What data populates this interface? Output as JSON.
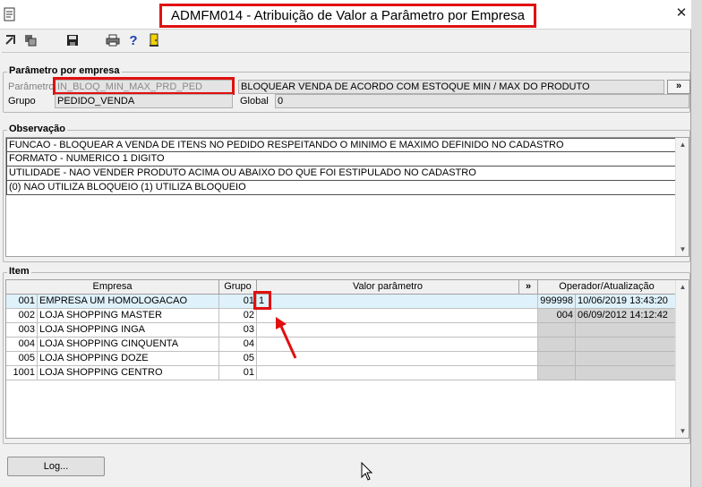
{
  "window": {
    "title": "ADMFM014 - Atribuição de Valor a Parâmetro por Empresa",
    "close_glyph": "✕"
  },
  "toolbar": {
    "icons": [
      "execute-icon",
      "copy-icon",
      "save-icon",
      "print-icon",
      "help-icon",
      "exit-door-icon"
    ],
    "help_glyph": "?"
  },
  "parametro_group": {
    "legend": "Parâmetro por empresa",
    "parametro_label": "Parâmetro",
    "parametro_code": "IN_BLOQ_MIN_MAX_PRD_PED",
    "parametro_desc": "BLOQUEAR VENDA DE ACORDO COM ESTOQUE MIN / MAX DO PRODUTO",
    "more_button": "»",
    "grupo_label": "Grupo",
    "grupo_value": "PEDIDO_VENDA",
    "global_label": "Global",
    "global_value": "0"
  },
  "observacao_group": {
    "legend": "Observação",
    "lines": [
      "FUNCAO - BLOQUEAR A VENDA DE ITENS NO PEDIDO RESPEITANDO O MINIMO E MAXIMO DEFINIDO NO CADASTRO",
      "FORMATO - NUMERICO 1 DIGITO",
      "UTILIDADE -  NAO VENDER PRODUTO ACIMA OU ABAIXO DO QUE FOI ESTIPULADO NO CADASTRO",
      "(0) NAO UTILIZA BLOQUEIO (1) UTILIZA BLOQUEIO"
    ]
  },
  "item_group": {
    "legend": "Item",
    "headers": {
      "empresa": "Empresa",
      "grupo": "Grupo",
      "valor": "Valor parâmetro",
      "more": "»",
      "operador": "Operador/Atualização"
    },
    "rows": [
      {
        "code": "001",
        "name": "EMPRESA UM  HOMOLOGACAO",
        "grupo": "01",
        "valor": "1",
        "operador": "999998",
        "data": "10/06/2019 13:43:20"
      },
      {
        "code": "002",
        "name": "LOJA SHOPPING MASTER",
        "grupo": "02",
        "valor": "",
        "operador": "004",
        "data": "06/09/2012 14:12:42"
      },
      {
        "code": "003",
        "name": "LOJA SHOPPING INGA",
        "grupo": "03",
        "valor": "",
        "operador": "",
        "data": ""
      },
      {
        "code": "004",
        "name": "LOJA SHOPPING CINQUENTA",
        "grupo": "04",
        "valor": "",
        "operador": "",
        "data": ""
      },
      {
        "code": "005",
        "name": "LOJA SHOPPING DOZE",
        "grupo": "05",
        "valor": "",
        "operador": "",
        "data": ""
      },
      {
        "code": "1001",
        "name": "LOJA SHOPPING  CENTRO",
        "grupo": "01",
        "valor": "",
        "operador": "",
        "data": ""
      }
    ]
  },
  "footer": {
    "log_button": "Log..."
  },
  "colors": {
    "annotation_red": "#e01010",
    "selected_row": "#dff1fb",
    "readonly_cell": "#d4d4d4"
  }
}
